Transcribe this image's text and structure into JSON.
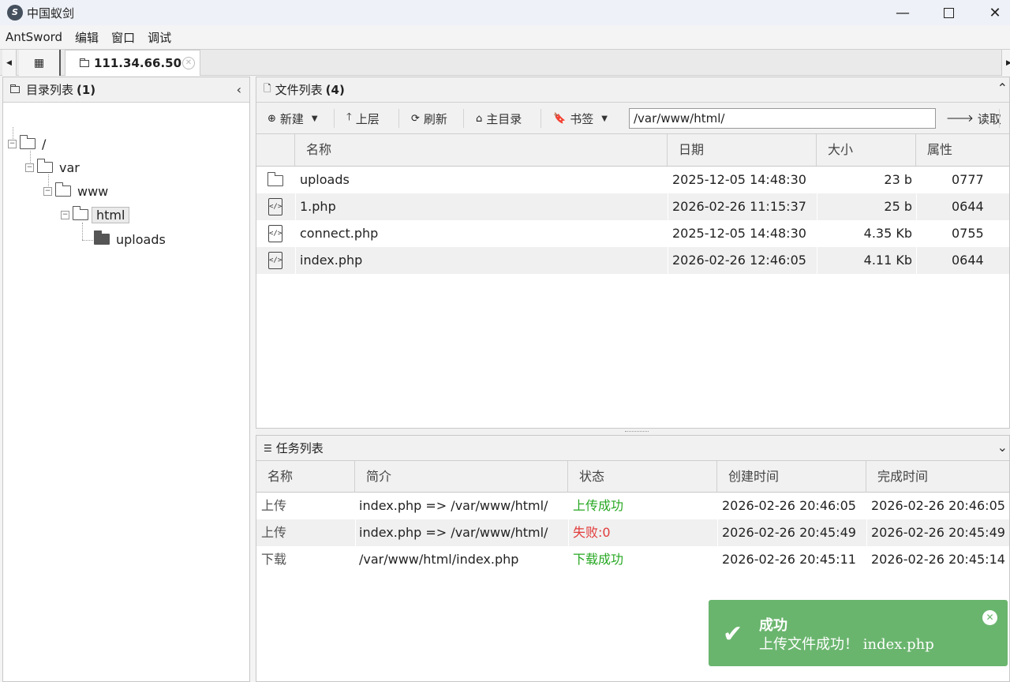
{
  "window": {
    "title": "中国蚁剑",
    "logo_text": "S",
    "minimize": "—",
    "close": "✕"
  },
  "menu": [
    "AntSword",
    "编辑",
    "窗口",
    "调试"
  ],
  "tabs": {
    "host": "111.34.66.50",
    "close": "✕"
  },
  "dir_panel": {
    "title": "目录列表",
    "count": "(1)",
    "collapse": "‹",
    "tree": [
      {
        "label": "/"
      },
      {
        "label": "var"
      },
      {
        "label": "www"
      },
      {
        "label": "html"
      },
      {
        "label": "uploads"
      }
    ]
  },
  "file_panel": {
    "title": "文件列表",
    "count": "(4)",
    "toolbar": {
      "new": "新建",
      "up": "上层",
      "refresh": "刷新",
      "home": "主目录",
      "bookmark": "书签",
      "path": "/var/www/html/",
      "read": "读取"
    },
    "columns": [
      "名称",
      "日期",
      "大小",
      "属性"
    ],
    "rows": [
      {
        "type": "folder",
        "name": "uploads",
        "date": "2025-12-05 14:48:30",
        "size": "23 b",
        "attr": "0777"
      },
      {
        "type": "php",
        "name": "1.php",
        "date": "2026-02-26 11:15:37",
        "size": "25 b",
        "attr": "0644"
      },
      {
        "type": "php",
        "name": "connect.php",
        "date": "2025-12-05 14:48:30",
        "size": "4.35 Kb",
        "attr": "0755"
      },
      {
        "type": "php",
        "name": "index.php",
        "date": "2026-02-26 12:46:05",
        "size": "4.11 Kb",
        "attr": "0644"
      }
    ]
  },
  "task_panel": {
    "title": "任务列表",
    "columns": [
      "名称",
      "简介",
      "状态",
      "创建时间",
      "完成时间"
    ],
    "rows": [
      {
        "name": "上传",
        "desc": "index.php => /var/www/html/",
        "status": "上传成功",
        "status_kind": "ok",
        "created": "2026-02-26 20:46:05",
        "done": "2026-02-26 20:46:05"
      },
      {
        "name": "上传",
        "desc": "index.php => /var/www/html/",
        "status": "失败:0",
        "status_kind": "fail",
        "created": "2026-02-26 20:45:49",
        "done": "2026-02-26 20:45:49"
      },
      {
        "name": "下载",
        "desc": "/var/www/html/index.php",
        "status": "下载成功",
        "status_kind": "ok",
        "created": "2026-02-26 20:45:11",
        "done": "2026-02-26 20:45:14"
      }
    ]
  },
  "toast": {
    "title": "成功",
    "message": "上传文件成功！ index.php",
    "color": "#6ab56e"
  },
  "colors": {
    "success": "#27a822",
    "fail": "#e23a3a"
  }
}
